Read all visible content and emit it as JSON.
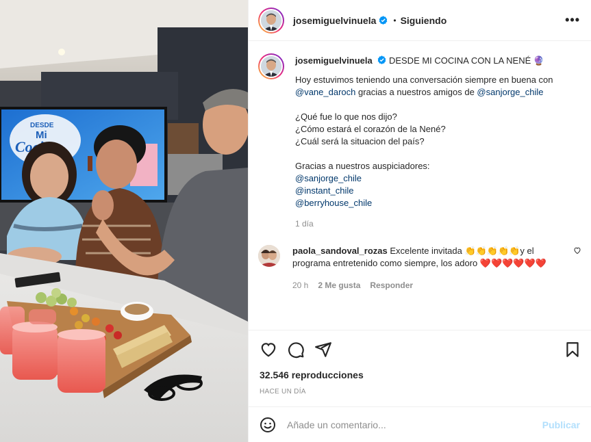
{
  "header": {
    "username": "josemiguelvinuela",
    "separator": "•",
    "follow_status": "Siguiendo",
    "more": "•••"
  },
  "caption": {
    "username": "josemiguelvinuela",
    "title": "DESDE MI COCINA CON LA NENÉ",
    "title_emoji": "🔮",
    "lines": {
      "l1a": "Hoy estuvimos teniendo una conversación siempre en buena con",
      "mention1": "@vane_daroch",
      "l2b": " gracias a nuestros amigos de ",
      "mention2": "@sanjorge_chile",
      "q1": "¿Qué fue lo que nos dijo?",
      "q2": "¿Cómo estará el corazón de la Nené?",
      "q3": "¿Cuál será la situacion del país?",
      "thanks": "Gracias a nuestros auspiciadores:",
      "s1": "@sanjorge_chile",
      "s2": "@instant_chile",
      "s3": "@berryhouse_chile"
    },
    "age": "1 día"
  },
  "comment": {
    "username": "paola_sandoval_rozas",
    "text_a": "Excelente invitada ",
    "claps": "👏👏👏👏👏",
    "text_b": "y el programa entretenido como siempre, los adoro ",
    "hearts": "❤️❤️❤️❤️❤️❤️",
    "time": "20 h",
    "likes": "2 Me gusta",
    "reply": "Responder"
  },
  "stats": {
    "views": "32.546 reproducciones",
    "posted": "HACE UN DÍA"
  },
  "composer": {
    "placeholder": "Añade un comentario...",
    "publish": "Publicar"
  },
  "media": {
    "tv_line1": "DESDE",
    "tv_line2": "Mi",
    "tv_line3": "Cocina"
  },
  "colors": {
    "verified": "#0095f6",
    "link": "#00376b",
    "publish_disabled": "#b2dffc",
    "heart": "#ed4956"
  },
  "icons": [
    "verified-icon",
    "more-icon",
    "heart-icon",
    "comment-icon",
    "share-icon",
    "bookmark-icon",
    "emoji-icon",
    "like-comment-icon"
  ]
}
